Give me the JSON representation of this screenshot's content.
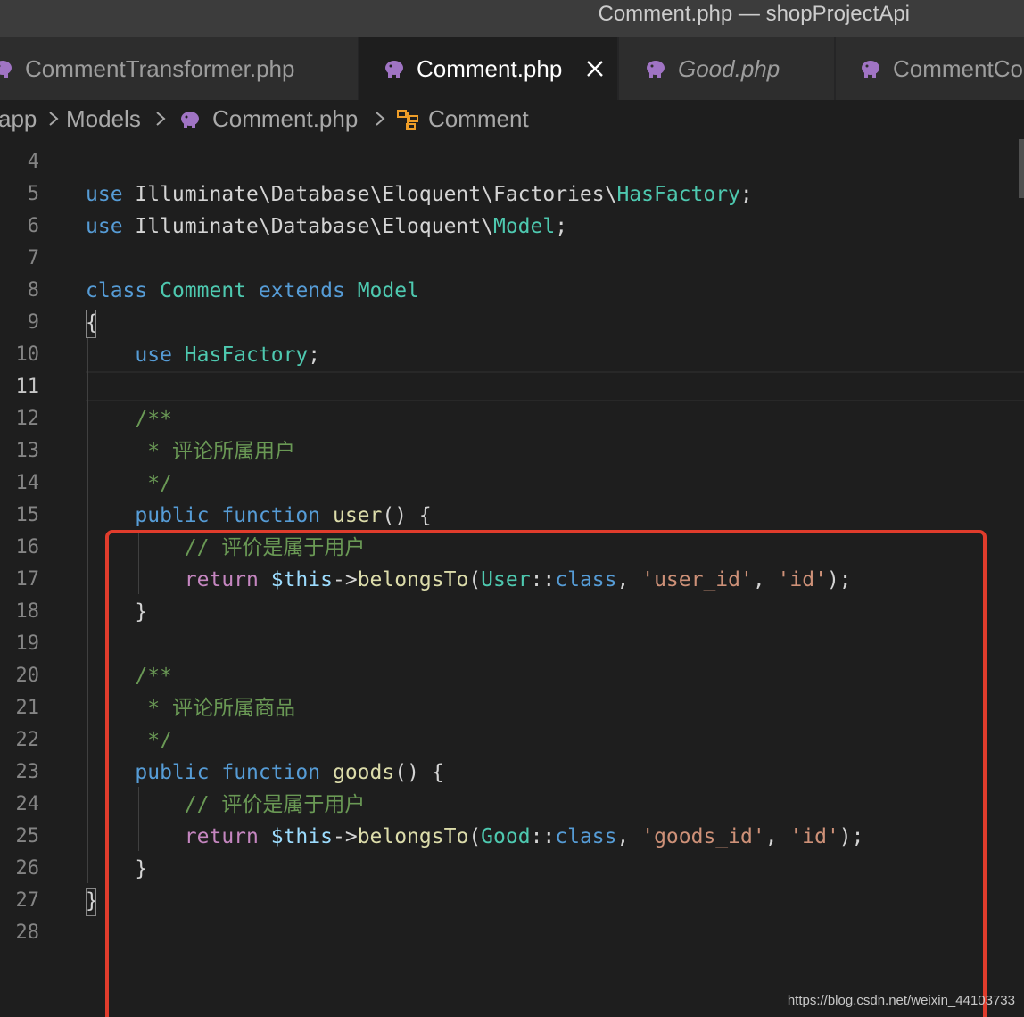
{
  "window": {
    "title": "Comment.php — shopProjectApi"
  },
  "tabs": [
    {
      "label": "CommentTransformer.php",
      "active": false,
      "italic": false,
      "icon": "php-elephant-icon"
    },
    {
      "label": "Comment.php",
      "active": true,
      "italic": false,
      "icon": "php-elephant-icon",
      "close": "close-icon"
    },
    {
      "label": "Good.php",
      "active": false,
      "italic": true,
      "icon": "php-elephant-icon"
    },
    {
      "label": "CommentCo",
      "active": false,
      "italic": false,
      "icon": "php-elephant-icon"
    }
  ],
  "breadcrumb": {
    "items": [
      "app",
      "Models",
      "Comment.php",
      "Comment"
    ],
    "icons": {
      "file": "php-elephant-icon",
      "symbol": "class-symbol-icon",
      "separator": "chevron-right-icon"
    }
  },
  "editor": {
    "cursor_line": 11,
    "lines": [
      {
        "n": 4,
        "tokens": []
      },
      {
        "n": 5,
        "tokens": [
          [
            "kw",
            "use"
          ],
          [
            "plain",
            " Illuminate\\Database\\Eloquent\\Factories\\"
          ],
          [
            "cls",
            "HasFactory"
          ],
          [
            "plain",
            ";"
          ]
        ]
      },
      {
        "n": 6,
        "tokens": [
          [
            "kw",
            "use"
          ],
          [
            "plain",
            " Illuminate\\Database\\Eloquent\\"
          ],
          [
            "cls",
            "Model"
          ],
          [
            "plain",
            ";"
          ]
        ]
      },
      {
        "n": 7,
        "tokens": []
      },
      {
        "n": 8,
        "tokens": [
          [
            "kw",
            "class"
          ],
          [
            "plain",
            " "
          ],
          [
            "cls",
            "Comment"
          ],
          [
            "plain",
            " "
          ],
          [
            "kw",
            "extends"
          ],
          [
            "plain",
            " "
          ],
          [
            "cls",
            "Model"
          ]
        ]
      },
      {
        "n": 9,
        "tokens": [
          [
            "plain",
            "{"
          ]
        ]
      },
      {
        "n": 10,
        "tokens": [
          [
            "plain",
            "    "
          ],
          [
            "kw",
            "use"
          ],
          [
            "plain",
            " "
          ],
          [
            "cls",
            "HasFactory"
          ],
          [
            "plain",
            ";"
          ]
        ]
      },
      {
        "n": 11,
        "tokens": []
      },
      {
        "n": 12,
        "tokens": [
          [
            "plain",
            "    "
          ],
          [
            "cmt",
            "/**"
          ]
        ]
      },
      {
        "n": 13,
        "tokens": [
          [
            "plain",
            "    "
          ],
          [
            "cmt",
            " * "
          ],
          [
            "cmtcjk",
            "评论所属用户"
          ]
        ]
      },
      {
        "n": 14,
        "tokens": [
          [
            "plain",
            "    "
          ],
          [
            "cmt",
            " */"
          ]
        ]
      },
      {
        "n": 15,
        "tokens": [
          [
            "plain",
            "    "
          ],
          [
            "kw",
            "public"
          ],
          [
            "plain",
            " "
          ],
          [
            "kw",
            "function"
          ],
          [
            "plain",
            " "
          ],
          [
            "fn",
            "user"
          ],
          [
            "plain",
            "() {"
          ]
        ]
      },
      {
        "n": 16,
        "tokens": [
          [
            "plain",
            "        "
          ],
          [
            "cmt",
            "// "
          ],
          [
            "cmtcjk",
            "评价是属于用户"
          ]
        ]
      },
      {
        "n": 17,
        "tokens": [
          [
            "plain",
            "        "
          ],
          [
            "ctl",
            "return"
          ],
          [
            "plain",
            " "
          ],
          [
            "var",
            "$this"
          ],
          [
            "plain",
            "->"
          ],
          [
            "fn",
            "belongsTo"
          ],
          [
            "plain",
            "("
          ],
          [
            "cls",
            "User"
          ],
          [
            "plain",
            "::"
          ],
          [
            "kw",
            "class"
          ],
          [
            "plain",
            ", "
          ],
          [
            "str",
            "'user_id'"
          ],
          [
            "plain",
            ", "
          ],
          [
            "str",
            "'id'"
          ],
          [
            "plain",
            ");"
          ]
        ]
      },
      {
        "n": 18,
        "tokens": [
          [
            "plain",
            "    }"
          ]
        ]
      },
      {
        "n": 19,
        "tokens": []
      },
      {
        "n": 20,
        "tokens": [
          [
            "plain",
            "    "
          ],
          [
            "cmt",
            "/**"
          ]
        ]
      },
      {
        "n": 21,
        "tokens": [
          [
            "plain",
            "    "
          ],
          [
            "cmt",
            " * "
          ],
          [
            "cmtcjk",
            "评论所属商品"
          ]
        ]
      },
      {
        "n": 22,
        "tokens": [
          [
            "plain",
            "    "
          ],
          [
            "cmt",
            " */"
          ]
        ]
      },
      {
        "n": 23,
        "tokens": [
          [
            "plain",
            "    "
          ],
          [
            "kw",
            "public"
          ],
          [
            "plain",
            " "
          ],
          [
            "kw",
            "function"
          ],
          [
            "plain",
            " "
          ],
          [
            "fn",
            "goods"
          ],
          [
            "plain",
            "() {"
          ]
        ]
      },
      {
        "n": 24,
        "tokens": [
          [
            "plain",
            "        "
          ],
          [
            "cmt",
            "// "
          ],
          [
            "cmtcjk",
            "评价是属于用户"
          ]
        ]
      },
      {
        "n": 25,
        "tokens": [
          [
            "plain",
            "        "
          ],
          [
            "ctl",
            "return"
          ],
          [
            "plain",
            " "
          ],
          [
            "var",
            "$this"
          ],
          [
            "plain",
            "->"
          ],
          [
            "fn",
            "belongsTo"
          ],
          [
            "plain",
            "("
          ],
          [
            "cls",
            "Good"
          ],
          [
            "plain",
            "::"
          ],
          [
            "kw",
            "class"
          ],
          [
            "plain",
            ", "
          ],
          [
            "str",
            "'goods_id'"
          ],
          [
            "plain",
            ", "
          ],
          [
            "str",
            "'id'"
          ],
          [
            "plain",
            ");"
          ]
        ]
      },
      {
        "n": 26,
        "tokens": [
          [
            "plain",
            "    }"
          ]
        ]
      },
      {
        "n": 27,
        "tokens": [
          [
            "plain",
            "}"
          ]
        ]
      },
      {
        "n": 28,
        "tokens": []
      }
    ]
  },
  "annotation": {
    "color": "#e03c2c"
  },
  "watermark": "https://blog.csdn.net/weixin_44103733",
  "colors": {
    "keyword": "#569cd6",
    "control": "#c586c0",
    "class": "#4ec9b0",
    "function": "#dcdcaa",
    "string": "#ce9178",
    "comment": "#6a9955",
    "variable": "#9cdcfe",
    "text": "#d4d4d4",
    "php_icon": "#a074c4",
    "symbol_icon": "#ee9d28"
  }
}
